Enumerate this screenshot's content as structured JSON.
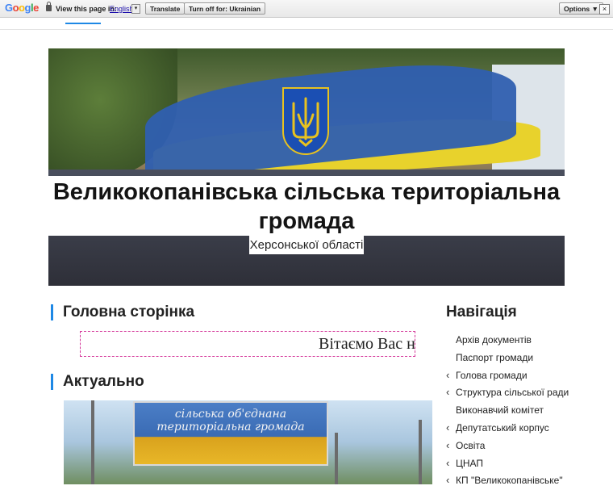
{
  "translate_bar": {
    "logo": "Google",
    "prompt": "View this page in:",
    "language": "English",
    "translate_label": "Translate",
    "turn_off_label": "Turn off for: Ukrainian",
    "options_label": "Options ▼",
    "close_glyph": "×"
  },
  "header": {
    "title": "Великокопанівська сільська територіальна громада",
    "region": "Херсонської області"
  },
  "main": {
    "home_heading": "Головна сторінка",
    "welcome_text": "Вітаємо Вас на",
    "news_heading": "Актуально",
    "billboard_line1": "сільська об'єднана",
    "billboard_line2": "територіальна громада"
  },
  "sidebar": {
    "title": "Навігація",
    "items": [
      {
        "label": "Архів документів",
        "expandable": false
      },
      {
        "label": "Паспорт громади",
        "expandable": false
      },
      {
        "label": "Голова громади",
        "expandable": true
      },
      {
        "label": "Структура сільської ради",
        "expandable": true
      },
      {
        "label": "Виконавчий комітет",
        "expandable": false
      },
      {
        "label": "Депутатський корпус",
        "expandable": true
      },
      {
        "label": "Освіта",
        "expandable": true
      },
      {
        "label": "ЦНАП",
        "expandable": true
      },
      {
        "label": "КП \"Великокопанівське\"",
        "expandable": true
      }
    ]
  },
  "colors": {
    "accent": "#1e88e5",
    "coat_blue": "#1b4fb3",
    "coat_gold": "#e8c21f"
  },
  "icons": {
    "nav_chevron": "chevron-left-icon",
    "lock": "lock-icon",
    "coat_of_arms": "trident-icon"
  }
}
